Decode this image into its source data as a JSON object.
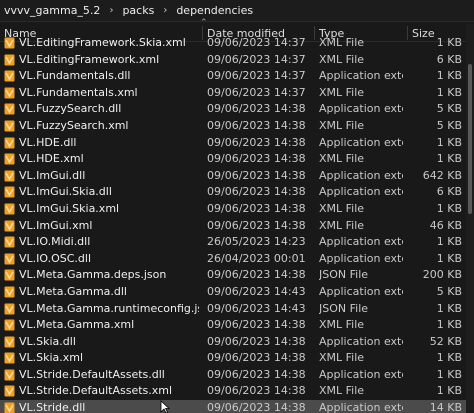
{
  "breadcrumb": {
    "items": [
      "vvvv_gamma_5.2",
      "packs",
      "dependencies"
    ],
    "separator": "›"
  },
  "columns": {
    "name": "Name",
    "date": "Date modified",
    "type": "Type",
    "size": "Size"
  },
  "files": [
    {
      "name": "VL.EditingFramework.Skia.xml",
      "date": "09/06/2023 14:37",
      "type": "XML File",
      "size": "1 KB",
      "icon": "xml-file-icon"
    },
    {
      "name": "VL.EditingFramework.xml",
      "date": "09/06/2023 14:37",
      "type": "XML File",
      "size": "6 KB",
      "icon": "xml-file-icon"
    },
    {
      "name": "VL.Fundamentals.dll",
      "date": "09/06/2023 14:37",
      "type": "Application exten...",
      "size": "1 KB",
      "icon": "dll-file-icon"
    },
    {
      "name": "VL.Fundamentals.xml",
      "date": "09/06/2023 14:37",
      "type": "XML File",
      "size": "1 KB",
      "icon": "xml-file-icon"
    },
    {
      "name": "VL.FuzzySearch.dll",
      "date": "09/06/2023 14:38",
      "type": "Application exten...",
      "size": "5 KB",
      "icon": "dll-file-icon"
    },
    {
      "name": "VL.FuzzySearch.xml",
      "date": "09/06/2023 14:38",
      "type": "XML File",
      "size": "5 KB",
      "icon": "xml-file-icon"
    },
    {
      "name": "VL.HDE.dll",
      "date": "09/06/2023 14:38",
      "type": "Application exten...",
      "size": "1 KB",
      "icon": "dll-file-icon"
    },
    {
      "name": "VL.HDE.xml",
      "date": "09/06/2023 14:38",
      "type": "XML File",
      "size": "1 KB",
      "icon": "xml-file-icon"
    },
    {
      "name": "VL.ImGui.dll",
      "date": "09/06/2023 14:38",
      "type": "Application exten...",
      "size": "642 KB",
      "icon": "dll-file-icon"
    },
    {
      "name": "VL.ImGui.Skia.dll",
      "date": "09/06/2023 14:38",
      "type": "Application exten...",
      "size": "6 KB",
      "icon": "dll-file-icon"
    },
    {
      "name": "VL.ImGui.Skia.xml",
      "date": "09/06/2023 14:38",
      "type": "XML File",
      "size": "1 KB",
      "icon": "xml-file-icon"
    },
    {
      "name": "VL.ImGui.xml",
      "date": "09/06/2023 14:38",
      "type": "XML File",
      "size": "46 KB",
      "icon": "xml-file-icon"
    },
    {
      "name": "VL.IO.Midi.dll",
      "date": "26/05/2023 14:23",
      "type": "Application exten...",
      "size": "1 KB",
      "icon": "dll-file-icon"
    },
    {
      "name": "VL.IO.OSC.dll",
      "date": "26/04/2023 00:01",
      "type": "Application exten...",
      "size": "1 KB",
      "icon": "dll-file-icon"
    },
    {
      "name": "VL.Meta.Gamma.deps.json",
      "date": "09/06/2023 14:38",
      "type": "JSON File",
      "size": "200 KB",
      "icon": "json-file-icon"
    },
    {
      "name": "VL.Meta.Gamma.dll",
      "date": "09/06/2023 14:43",
      "type": "Application exten...",
      "size": "5 KB",
      "icon": "dll-file-icon"
    },
    {
      "name": "VL.Meta.Gamma.runtimeconfig.json",
      "date": "09/06/2023 14:43",
      "type": "JSON File",
      "size": "1 KB",
      "icon": "json-file-icon"
    },
    {
      "name": "VL.Meta.Gamma.xml",
      "date": "09/06/2023 14:38",
      "type": "XML File",
      "size": "1 KB",
      "icon": "xml-file-icon"
    },
    {
      "name": "VL.Skia.dll",
      "date": "09/06/2023 14:38",
      "type": "Application exten...",
      "size": "52 KB",
      "icon": "dll-file-icon"
    },
    {
      "name": "VL.Skia.xml",
      "date": "09/06/2023 14:38",
      "type": "XML File",
      "size": "1 KB",
      "icon": "xml-file-icon"
    },
    {
      "name": "VL.Stride.DefaultAssets.dll",
      "date": "09/06/2023 14:38",
      "type": "Application exten...",
      "size": "1 KB",
      "icon": "dll-file-icon"
    },
    {
      "name": "VL.Stride.DefaultAssets.xml",
      "date": "09/06/2023 14:38",
      "type": "XML File",
      "size": "1 KB",
      "icon": "xml-file-icon"
    },
    {
      "name": "VL.Stride.dll",
      "date": "09/06/2023 14:38",
      "type": "Application exten...",
      "size": "14 KB",
      "icon": "dll-file-icon",
      "selected": true
    }
  ],
  "colors": {
    "background": "#191919",
    "selected_row": "#4b4b4b",
    "vl_icon_orange": "#f0a020",
    "vl_icon_light": "#ffd9a0"
  }
}
